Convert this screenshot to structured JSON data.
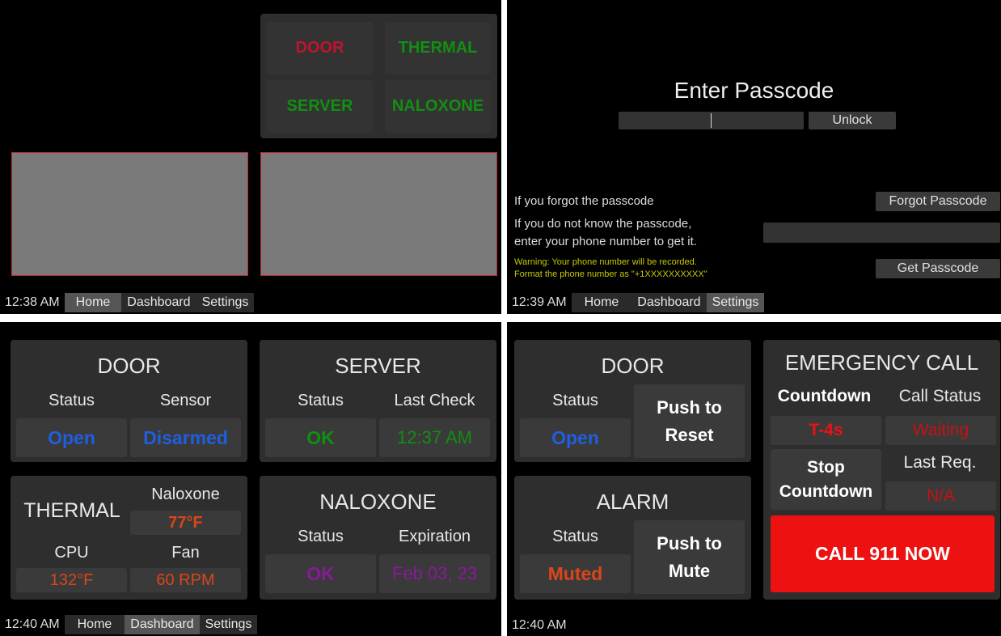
{
  "home": {
    "tiles": [
      {
        "label": "DOOR",
        "color": "#c0142c"
      },
      {
        "label": "THERMAL",
        "color": "#128f12"
      },
      {
        "label": "SERVER",
        "color": "#128f12"
      },
      {
        "label": "NALOXONE",
        "color": "#128f12"
      }
    ],
    "taskbar": {
      "time": "12:38 AM",
      "tabs": [
        "Home",
        "Dashboard",
        "Settings"
      ],
      "active": "Home"
    }
  },
  "settings": {
    "title": "Enter Passcode",
    "unlock_label": "Unlock",
    "forgot_text": "If you forgot the passcode",
    "forgot_button": "Forgot Passcode",
    "unknown_text_line1": "If you do not know the passcode,",
    "unknown_text_line2": "enter your phone number to get it.",
    "warning_line1": "Warning: Your phone number will be recorded.",
    "warning_line2": "Format the phone number as \"+1XXXXXXXXXX\"",
    "get_button": "Get Passcode",
    "taskbar": {
      "time": "12:39 AM",
      "tabs": [
        "Home",
        "Dashboard",
        "Settings"
      ],
      "active": "Settings"
    }
  },
  "dashboard": {
    "door": {
      "title": "DOOR",
      "status_label": "Status",
      "status_value": "Open",
      "sensor_label": "Sensor",
      "sensor_value": "Disarmed"
    },
    "server": {
      "title": "SERVER",
      "status_label": "Status",
      "status_value": "OK",
      "check_label": "Last Check",
      "check_value": "12:37 AM"
    },
    "thermal": {
      "title": "THERMAL",
      "naloxone_label": "Naloxone",
      "naloxone_value": "77°F",
      "cpu_label": "CPU",
      "cpu_value": "132°F",
      "fan_label": "Fan",
      "fan_value": "60 RPM"
    },
    "naloxone": {
      "title": "NALOXONE",
      "status_label": "Status",
      "status_value": "OK",
      "exp_label": "Expiration",
      "exp_value": "Feb 03, 23"
    },
    "taskbar": {
      "time": "12:40 AM",
      "tabs": [
        "Home",
        "Dashboard",
        "Settings"
      ],
      "active": "Dashboard"
    }
  },
  "emergency": {
    "door": {
      "title": "DOOR",
      "status_label": "Status",
      "status_value": "Open",
      "reset_line1": "Push to",
      "reset_line2": "Reset"
    },
    "alarm": {
      "title": "ALARM",
      "status_label": "Status",
      "status_value": "Muted",
      "mute_line1": "Push to",
      "mute_line2": "Mute"
    },
    "call": {
      "title": "EMERGENCY CALL",
      "countdown_label": "Countdown",
      "countdown_value": "T-4s",
      "call_status_label": "Call Status",
      "call_status_value": "Waiting",
      "stop_line1": "Stop",
      "stop_line2": "Countdown",
      "last_req_label": "Last Req.",
      "last_req_value": "N/A",
      "call_button": "CALL 911 NOW"
    },
    "time": "12:40 AM"
  }
}
